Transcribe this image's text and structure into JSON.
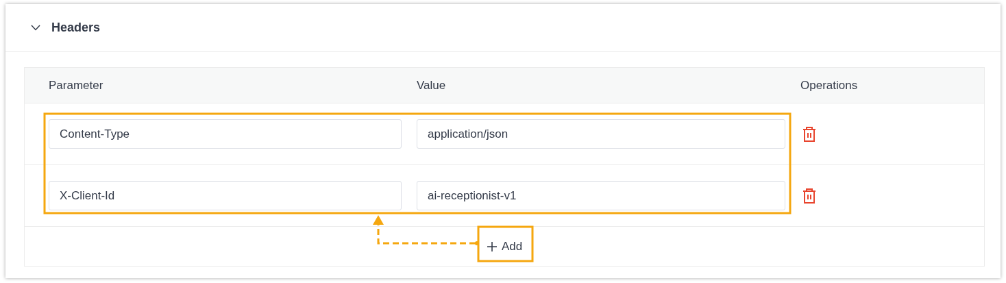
{
  "section": {
    "title": "Headers",
    "expanded": true
  },
  "table": {
    "columns": [
      "Parameter",
      "Value",
      "Operations"
    ],
    "rows": [
      {
        "parameter": "Content-Type",
        "value": "application/json"
      },
      {
        "parameter": "X-Client-Id",
        "value": "ai-receptionist-v1"
      }
    ]
  },
  "add_button": {
    "label": "Add"
  }
}
